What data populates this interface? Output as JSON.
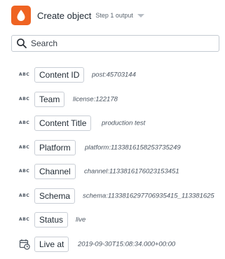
{
  "header": {
    "title": "Create object",
    "subtitle": "Step 1 output",
    "app_icon": "droplet-icon",
    "accent_color": "#ef6322"
  },
  "search": {
    "placeholder": "Search",
    "value": ""
  },
  "fields": [
    {
      "type": "ABC",
      "label": "Content ID",
      "value": "post:45703144"
    },
    {
      "type": "ABC",
      "label": "Team",
      "value": "license:122178"
    },
    {
      "type": "ABC",
      "label": "Content Title",
      "value": "production test"
    },
    {
      "type": "ABC",
      "label": "Platform",
      "value": "platform:1133816158253735249"
    },
    {
      "type": "ABC",
      "label": "Channel",
      "value": "channel:1133816176023153451"
    },
    {
      "type": "ABC",
      "label": "Schema",
      "value": "schema:1133816297706935415_113381625"
    },
    {
      "type": "ABC",
      "label": "Status",
      "value": "live"
    },
    {
      "type": "datetime",
      "icon": "calendar-clock-icon",
      "label": "Live at",
      "value": "2019-09-30T15:08:34.000+00:00"
    }
  ]
}
